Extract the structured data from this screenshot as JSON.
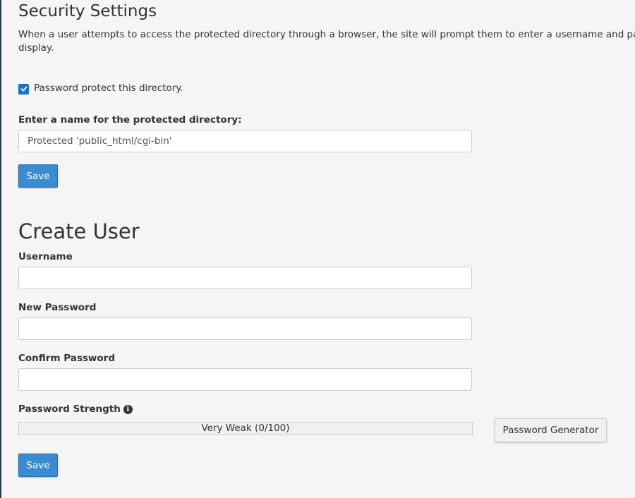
{
  "security_settings": {
    "title": "Security Settings",
    "description": "When a user attempts to access the protected directory through a browser, the site will prompt them to enter a username and password before access is granted. You may also specify a name for the protected directory which will display.",
    "description_visible_line1": "When a user attempts to access the protected directory through a browser, the site will prompt them to enter a username and passwo",
    "description_visible_line2": "display.",
    "protect_checkbox_label": "Password protect this directory.",
    "protect_checkbox_checked": true,
    "directory_name_label": "Enter a name for the protected directory:",
    "directory_name_value": "Protected 'public_html/cgi-bin'",
    "save_label": "Save"
  },
  "create_user": {
    "title": "Create User",
    "username_label": "Username",
    "username_value": "",
    "new_password_label": "New Password",
    "new_password_value": "",
    "confirm_password_label": "Confirm Password",
    "confirm_password_value": "",
    "strength_label": "Password Strength",
    "strength_text": "Very Weak (0/100)",
    "strength_value": 0,
    "generator_label": "Password Generator",
    "save_label": "Save"
  },
  "icons": {
    "checkbox": "check-icon",
    "info": "info-circle-icon"
  },
  "colors": {
    "primary_button": "#3a8bd1",
    "checkbox": "#1a73c9",
    "background": "#f5f5f5"
  }
}
